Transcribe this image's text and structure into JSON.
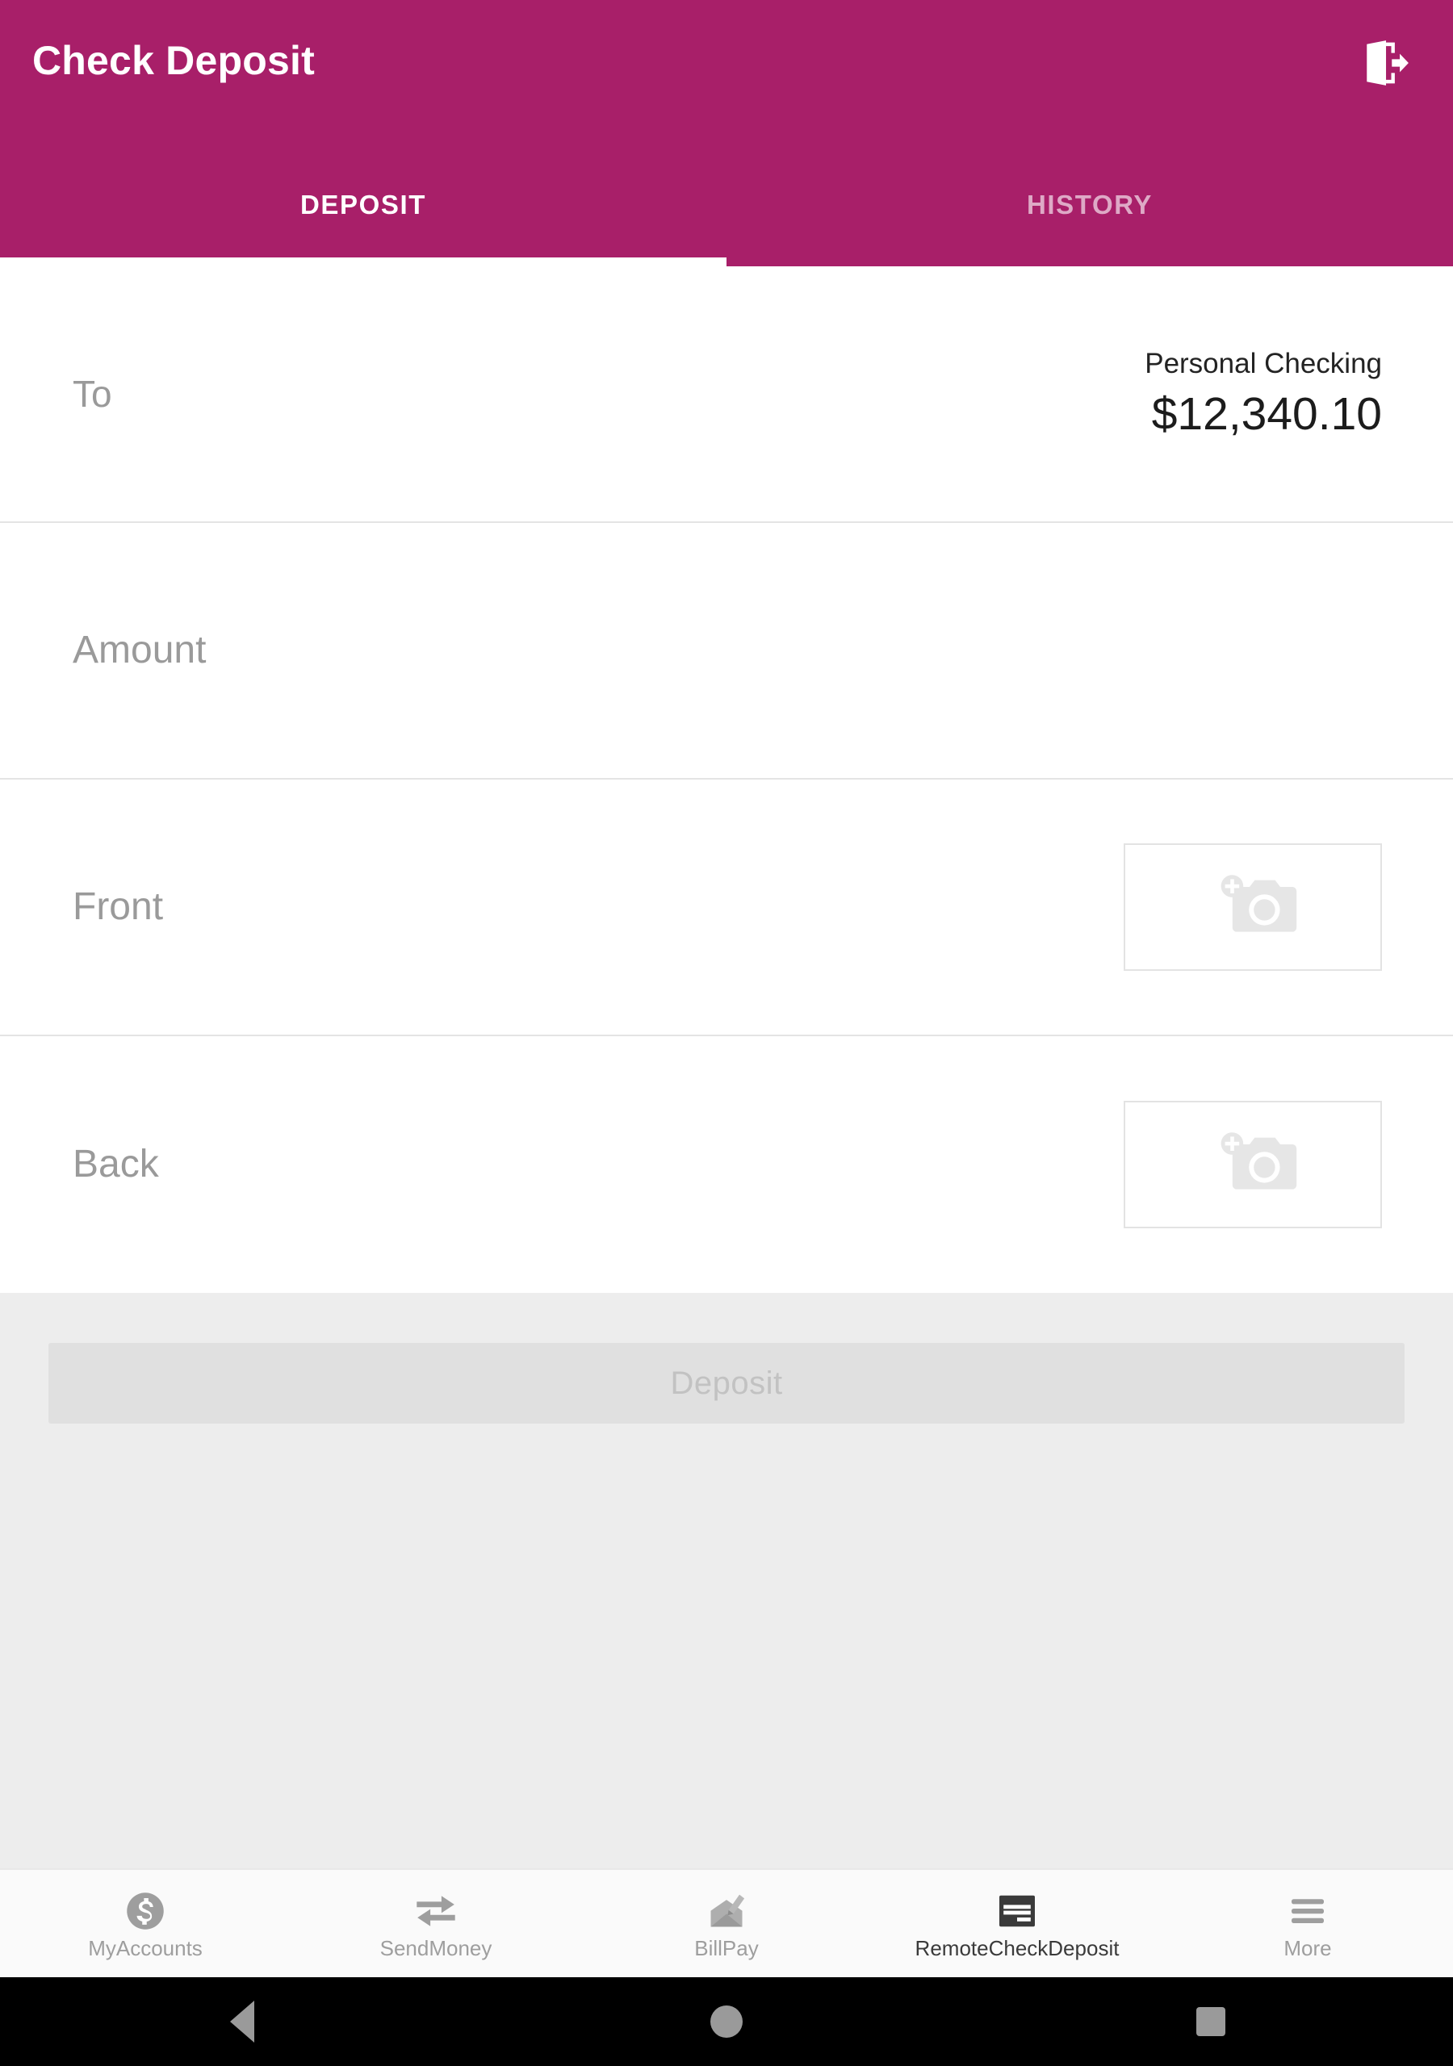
{
  "appbar": {
    "title": "Check Deposit",
    "logout_icon": "logout-icon"
  },
  "tabs": [
    {
      "label": "DEPOSIT",
      "active": true
    },
    {
      "label": "HISTORY",
      "active": false
    }
  ],
  "form": {
    "to": {
      "label": "To",
      "account_name": "Personal Checking",
      "account_balance": "$12,340.10"
    },
    "amount": {
      "label": "Amount",
      "value": "",
      "placeholder": "Amount"
    },
    "front": {
      "label": "Front",
      "capture_icon": "add-photo-camera-icon"
    },
    "back": {
      "label": "Back",
      "capture_icon": "add-photo-camera-icon"
    }
  },
  "action": {
    "deposit_label": "Deposit",
    "deposit_enabled": false
  },
  "bottom_nav": [
    {
      "label": "MyAccounts",
      "icon": "dollar-circle-icon",
      "active": false
    },
    {
      "label": "SendMoney",
      "icon": "transfer-arrows-icon",
      "active": false
    },
    {
      "label": "BillPay",
      "icon": "envelope-pen-icon",
      "active": false
    },
    {
      "label": "RemoteCheckDeposit",
      "icon": "check-document-icon",
      "active": true
    },
    {
      "label": "More",
      "icon": "hamburger-menu-icon",
      "active": false
    }
  ],
  "system_nav": {
    "back": "back-triangle-icon",
    "home": "home-circle-icon",
    "recents": "recents-square-icon"
  },
  "colors": {
    "brand": "#a81f69",
    "footer_bg": "#ededed",
    "disabled_button": "#e0e0e0",
    "nav_active_text": "#3a3a3a",
    "nav_inactive_text": "#9e9e9e"
  }
}
